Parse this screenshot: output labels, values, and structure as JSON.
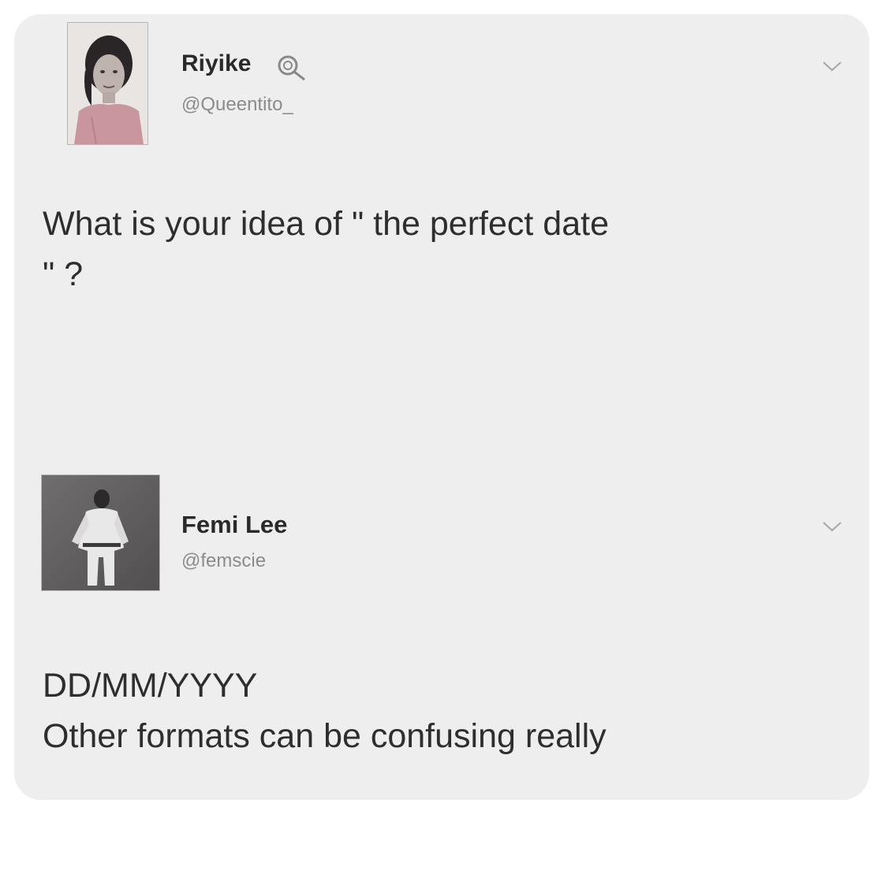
{
  "tweets": [
    {
      "display_name": "Riyike",
      "handle": "@Queentito_",
      "text_line1": "What is your idea of \" the perfect date",
      "text_line2": "\" ?",
      "verified_icon": "magnifier-badge-icon",
      "menu_icon": "chevron-down-icon"
    },
    {
      "display_name": "Femi Lee",
      "handle": "@femscie",
      "text_line1": "DD/MM/YYYY",
      "text_line2": "Other formats can be confusing really",
      "menu_icon": "chevron-down-icon"
    }
  ],
  "colors": {
    "card_background": "#efeeef",
    "page_background": "#ffffff",
    "name_text": "#2b2a2b",
    "handle_text": "#8c8a8b",
    "body_text": "#2f2e2f"
  }
}
